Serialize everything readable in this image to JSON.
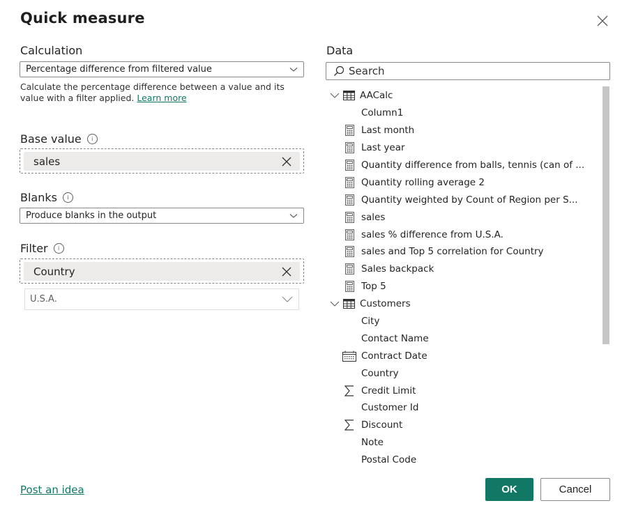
{
  "dialog": {
    "title": "Quick measure",
    "close_label": "Close"
  },
  "calculation": {
    "label": "Calculation",
    "selected": "Percentage difference from filtered value",
    "description": "Calculate the percentage difference between a value and its value with a filter applied.",
    "learn_more": "Learn more"
  },
  "base_value": {
    "label": "Base value",
    "info_icon": "info-icon",
    "value": "sales"
  },
  "blanks": {
    "label": "Blanks",
    "info_icon": "info-icon",
    "selected": "Produce blanks in the output"
  },
  "filter": {
    "label": "Filter",
    "info_icon": "info-icon",
    "field": "Country",
    "value": "U.S.A."
  },
  "data_pane": {
    "label": "Data",
    "search_placeholder": "Search",
    "tables": [
      {
        "name": "AACalc",
        "expanded": true,
        "icon": "table-icon",
        "fields": [
          {
            "name": "Column1",
            "icon": ""
          },
          {
            "name": "Last month",
            "icon": "calculator-icon"
          },
          {
            "name": "Last year",
            "icon": "calculator-icon"
          },
          {
            "name": "Quantity difference from balls, tennis (can of ...",
            "icon": "calculator-icon"
          },
          {
            "name": "Quantity rolling average 2",
            "icon": "calculator-icon"
          },
          {
            "name": "Quantity weighted by Count of Region per S...",
            "icon": "calculator-icon"
          },
          {
            "name": "sales",
            "icon": "calculator-icon"
          },
          {
            "name": "sales % difference from U.S.A.",
            "icon": "calculator-icon"
          },
          {
            "name": "sales and Top 5 correlation for Country",
            "icon": "calculator-icon"
          },
          {
            "name": "Sales backpack",
            "icon": "calculator-icon"
          },
          {
            "name": "Top 5",
            "icon": "calculator-icon"
          }
        ]
      },
      {
        "name": "Customers",
        "expanded": true,
        "icon": "table-icon",
        "fields": [
          {
            "name": "City",
            "icon": ""
          },
          {
            "name": "Contact Name",
            "icon": ""
          },
          {
            "name": "Contract Date",
            "icon": "calendar-icon",
            "expandable": true
          },
          {
            "name": "Country",
            "icon": ""
          },
          {
            "name": "Credit Limit",
            "icon": "sigma-icon"
          },
          {
            "name": "Customer Id",
            "icon": ""
          },
          {
            "name": "Discount",
            "icon": "sigma-icon"
          },
          {
            "name": "Note",
            "icon": ""
          },
          {
            "name": "Postal Code",
            "icon": ""
          }
        ]
      }
    ]
  },
  "footer": {
    "post_idea": "Post an idea",
    "ok": "OK",
    "cancel": "Cancel"
  },
  "colors": {
    "accent": "#117865",
    "pill_bg": "#edebe9",
    "scrollbar": "#c8c6c4"
  }
}
